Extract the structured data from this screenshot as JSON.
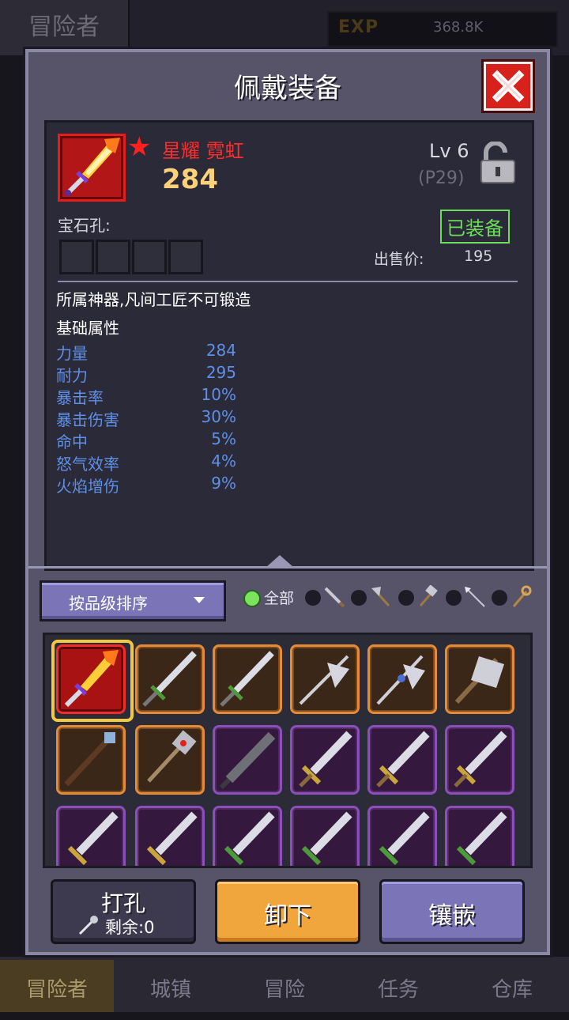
{
  "top_bar": {
    "title": "冒险者",
    "exp_label": "EXP",
    "exp_value": "368.8K"
  },
  "modal": {
    "title": "佩戴装备",
    "item": {
      "name": "星耀 霓虹",
      "power": "284",
      "level": "Lv 6",
      "level_sub": "(P29)",
      "gem_label": "宝石孔:",
      "status": "已装备",
      "price_label": "出售价:",
      "price_value": "195",
      "description": "所属神器,凡间工匠不可锻造",
      "base_title": "基础属性",
      "stats": [
        {
          "name": "力量",
          "value": "284"
        },
        {
          "name": "耐力",
          "value": "295"
        },
        {
          "name": "暴击率",
          "value": "10%"
        },
        {
          "name": "暴击伤害",
          "value": "30%"
        },
        {
          "name": "命中",
          "value": "5%"
        },
        {
          "name": "怒气效率",
          "value": "4%"
        },
        {
          "name": "火焰增伤",
          "value": "9%"
        }
      ]
    },
    "sort_label": "按品级排序",
    "filter_all": "全部",
    "filters": [
      "sword-icon",
      "axe-icon",
      "hammer-icon",
      "spear-icon",
      "staff-icon"
    ],
    "buttons": {
      "drill": "打孔",
      "drill_remaining": "剩余:0",
      "unequip": "卸下",
      "inlay": "镶嵌"
    }
  },
  "bottom_nav": [
    "冒险者",
    "城镇",
    "冒险",
    "任务",
    "仓库"
  ],
  "colors": {
    "legendary": "#ff2d2d",
    "power": "#ffd27a",
    "equipped": "#6ddc5b",
    "stat": "#5f8fe6",
    "unequip_button": "#f0a63c"
  }
}
